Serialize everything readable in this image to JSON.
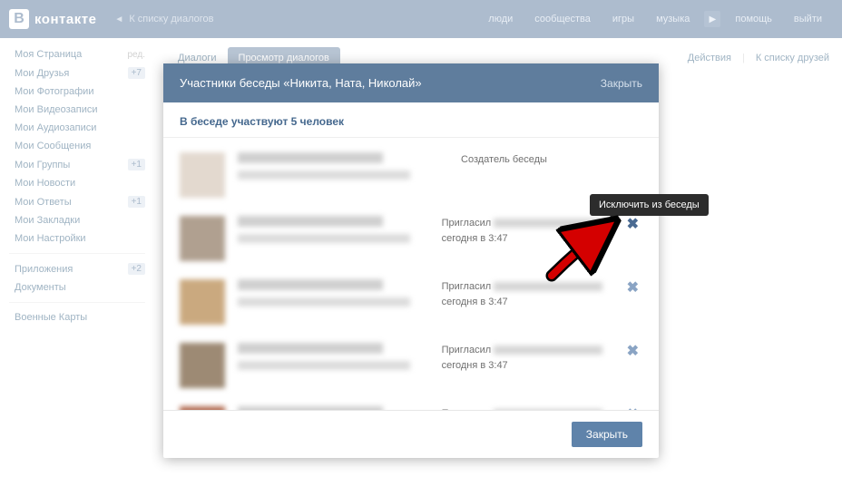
{
  "header": {
    "logo_letter": "В",
    "logo_text": "контакте",
    "back_label": "К списку диалогов",
    "nav": {
      "people": "люди",
      "communities": "сообщества",
      "games": "игры",
      "music": "музыка",
      "help": "помощь",
      "logout": "выйти"
    }
  },
  "sidebar": {
    "items": [
      {
        "label": "Моя Страница",
        "extra": "ред."
      },
      {
        "label": "Мои Друзья",
        "badge": "+7"
      },
      {
        "label": "Мои Фотографии"
      },
      {
        "label": "Мои Видеозаписи"
      },
      {
        "label": "Мои Аудиозаписи"
      },
      {
        "label": "Мои Сообщения"
      },
      {
        "label": "Мои Группы",
        "badge": "+1"
      },
      {
        "label": "Мои Новости"
      },
      {
        "label": "Мои Ответы",
        "badge": "+1"
      },
      {
        "label": "Мои Закладки"
      },
      {
        "label": "Мои Настройки"
      }
    ],
    "group2": [
      {
        "label": "Приложения",
        "badge": "+2"
      },
      {
        "label": "Документы"
      }
    ],
    "group3": [
      {
        "label": "Военные Карты"
      }
    ]
  },
  "content": {
    "tabs": {
      "dialogs": "Диалоги",
      "view": "Просмотр диалогов"
    },
    "actions": "Действия",
    "to_friends": "К списку друзей"
  },
  "modal": {
    "title": "Участники беседы «Никита, Ната, Николай»",
    "close_link": "Закрыть",
    "subtitle": "В беседе участвуют 5 человек",
    "creator_label": "Создатель беседы",
    "invited_prefix": "Пригласил",
    "invited_time": "сегодня в 3:47",
    "close_btn": "Закрыть",
    "tooltip": "Исключить из беседы",
    "participants": [
      {
        "role": "creator"
      },
      {
        "role": "invited",
        "highlight": true
      },
      {
        "role": "invited"
      },
      {
        "role": "invited"
      },
      {
        "role": "invited"
      }
    ]
  }
}
